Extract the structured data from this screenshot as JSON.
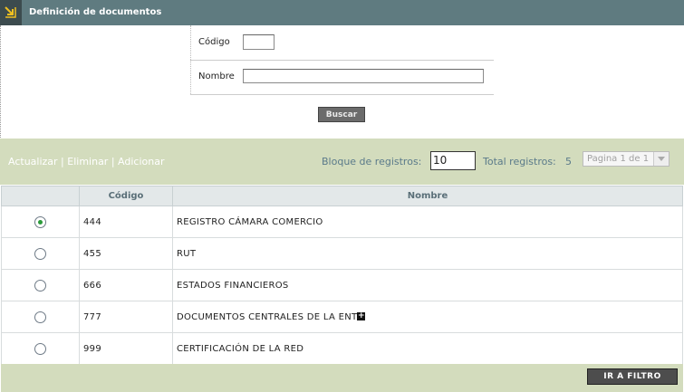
{
  "header": {
    "title": "Definición de documentos",
    "icon": "corner-arrow-icon"
  },
  "form": {
    "codigo_label": "Código",
    "codigo_value": "",
    "nombre_label": "Nombre",
    "nombre_value": "",
    "buscar_label": "Buscar"
  },
  "toolbar": {
    "actualizar": "Actualizar",
    "eliminar": "Eliminar",
    "adicionar": "Adicionar",
    "separator": " | ",
    "bloque_label": "Bloque de registros:",
    "bloque_value": "10",
    "total_label": "Total registros:",
    "total_value": "5",
    "pager_value": "Pagina 1 de 1"
  },
  "table": {
    "columns": [
      "",
      "Código",
      "Nombre"
    ],
    "rows": [
      {
        "codigo": "444",
        "nombre": "REGISTRO CÁMARA COMERCIO",
        "selected": true
      },
      {
        "codigo": "455",
        "nombre": "RUT",
        "selected": false
      },
      {
        "codigo": "666",
        "nombre": "ESTADOS FINANCIEROS",
        "selected": false
      },
      {
        "codigo": "777",
        "nombre": "DOCUMENTOS CENTRALES DE LA ENT",
        "selected": false,
        "expand": true
      },
      {
        "codigo": "999",
        "nombre": "CERTIFICACIÓN DE LA RED",
        "selected": false
      }
    ]
  },
  "footer": {
    "ir_filtro_label": "IR A FILTRO"
  },
  "colors": {
    "header_bg": "#5f7b80",
    "band_bg": "#d3dcbd",
    "label_blue": "#5a7a8a",
    "radio_selected": "#2b9a3a"
  }
}
